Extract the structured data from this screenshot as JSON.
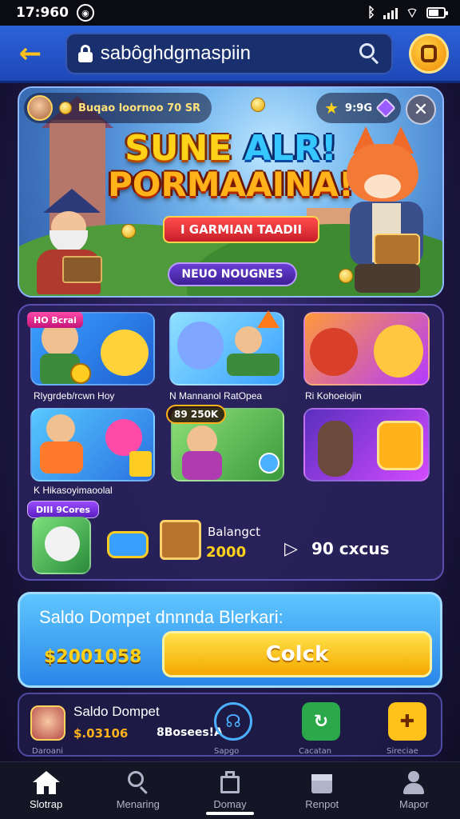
{
  "status_bar": {
    "time": "17:960"
  },
  "top_bar": {
    "url": "sabôghdgmaspiin"
  },
  "hero": {
    "player_info": "Buqao loornoo 70 SR",
    "stats": "9:9G",
    "title_line1_a": "SUNE ",
    "title_line1_b": "ALR!",
    "title_line2": "PORMAAINA!",
    "ribbon": "I GARMIAN TAADII",
    "cta": "NEUO NOUGNES"
  },
  "games": {
    "badge_top": "HO Bcrai",
    "tile_labels": [
      "Rlygrdeb/rcwn Hoy",
      "N Mannanol RatOpea",
      "Ri Kohoeiojin",
      "K Hikasoyimaoolal"
    ],
    "promo_tag": "89 250K",
    "row3_badge": "DIII 9Cores",
    "balance_label": "Balangct",
    "balance_value": "2000",
    "count": "90 cxcus"
  },
  "wallet": {
    "title": "Saldo Dompet dnnnda Blerkari:",
    "amount": "$2001058",
    "claim_label": "Colck"
  },
  "quick_panel": {
    "title": "Saldo Dompet",
    "amount": "$.03106",
    "sub": "8Bosees!A",
    "captions": [
      "Daroani",
      "Sapgo",
      "Cacatan",
      "Sireciae"
    ]
  },
  "bottom_nav": {
    "items": [
      {
        "label": "Slotrap"
      },
      {
        "label": "Menaring"
      },
      {
        "label": "Domay"
      },
      {
        "label": "Renpot"
      },
      {
        "label": "Mapor"
      }
    ]
  },
  "colors": {
    "accent_blue": "#2c63d8",
    "accent_gold": "#ffd21a",
    "claim_button": "#f5a800"
  }
}
